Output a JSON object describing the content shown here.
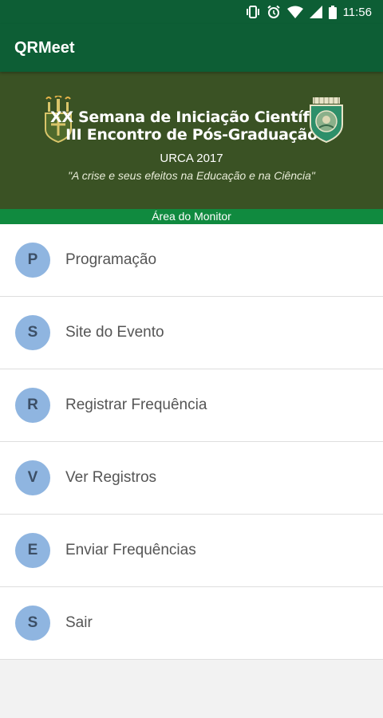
{
  "status_bar": {
    "time": "11:56",
    "icons": [
      "vibrate-icon",
      "alarm-icon",
      "wifi-icon",
      "signal-icon",
      "battery-icon"
    ]
  },
  "app_bar": {
    "title": "QRMeet"
  },
  "banner": {
    "title_line1": "XX Semana de Iniciação Científica",
    "title_line2": "III Encontro de Pós-Graduação",
    "subtitle": "URCA 2017",
    "quote": "\"A crise e seus efeitos na Educação e na Ciência\""
  },
  "section_bar": {
    "label": "Área do Monitor"
  },
  "menu": {
    "items": [
      {
        "initial": "P",
        "label": "Programação"
      },
      {
        "initial": "S",
        "label": "Site do Evento"
      },
      {
        "initial": "R",
        "label": "Registrar Frequência"
      },
      {
        "initial": "V",
        "label": "Ver Registros"
      },
      {
        "initial": "E",
        "label": "Enviar Frequências"
      },
      {
        "initial": "S",
        "label": "Sair"
      }
    ]
  },
  "colors": {
    "app_bar": "#0d5e35",
    "banner_bg": "#3a5224",
    "section_bar": "#108a3f",
    "avatar_bg": "#8fb5e0"
  }
}
